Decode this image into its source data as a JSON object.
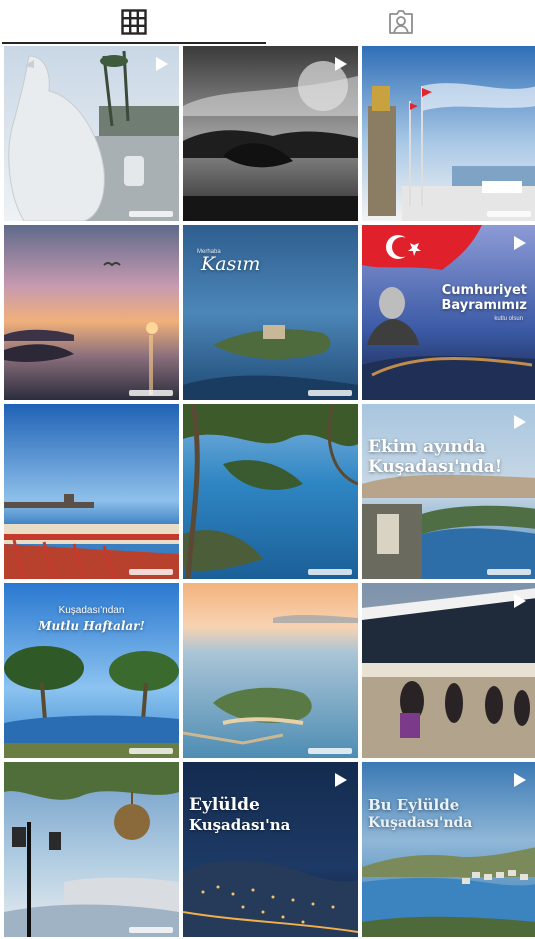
{
  "tabs": [
    {
      "name": "grid",
      "icon": "grid-icon",
      "active": true
    },
    {
      "name": "tagged",
      "icon": "tagged-person-icon",
      "active": false
    }
  ],
  "posts": [
    {
      "id": "p1",
      "scene": "white-dove-statue-waterfront",
      "reel": true
    },
    {
      "id": "p2",
      "scene": "black-white-bay-island",
      "reel": true
    },
    {
      "id": "p3",
      "scene": "monument-flags-harbour",
      "reel": false
    },
    {
      "id": "p4",
      "scene": "sunset-sea-bird",
      "reel": false
    },
    {
      "id": "p5",
      "scene": "pigeon-island-blue",
      "reel": false,
      "caption_script": "Kasım",
      "caption_small": "Merhaba"
    },
    {
      "id": "p6",
      "scene": "republic-day-flag",
      "reel": true,
      "caption_lines": [
        "Cumhuriyet",
        "Bayramımız"
      ],
      "caption_sub": "kutlu olsun"
    },
    {
      "id": "p7",
      "scene": "castle-red-railing",
      "reel": false
    },
    {
      "id": "p8",
      "scene": "pine-view-coast",
      "reel": false
    },
    {
      "id": "p9",
      "scene": "coastal-town-october",
      "reel": true,
      "caption_lines": [
        "Ekim ayında",
        "Kuşadası'nda!"
      ]
    },
    {
      "id": "p10",
      "scene": "pine-trees-lake",
      "reel": false,
      "caption_lines": [
        "Kuşadası'ndan",
        "Mutlu Haftalar!"
      ]
    },
    {
      "id": "p11",
      "scene": "island-pastel-sea",
      "reel": false
    },
    {
      "id": "p12",
      "scene": "cruise-ship-dancers",
      "reel": true
    },
    {
      "id": "p13",
      "scene": "lantern-harbour-view",
      "reel": false
    },
    {
      "id": "p14",
      "scene": "night-city-lights",
      "reel": true,
      "caption_lines": [
        "Eylülde",
        "Kuşadası'na"
      ]
    },
    {
      "id": "p15",
      "scene": "aerial-bay-daylight",
      "reel": true,
      "caption_lines": [
        "Bu Eylülde",
        "Kuşadası'nda"
      ]
    }
  ]
}
